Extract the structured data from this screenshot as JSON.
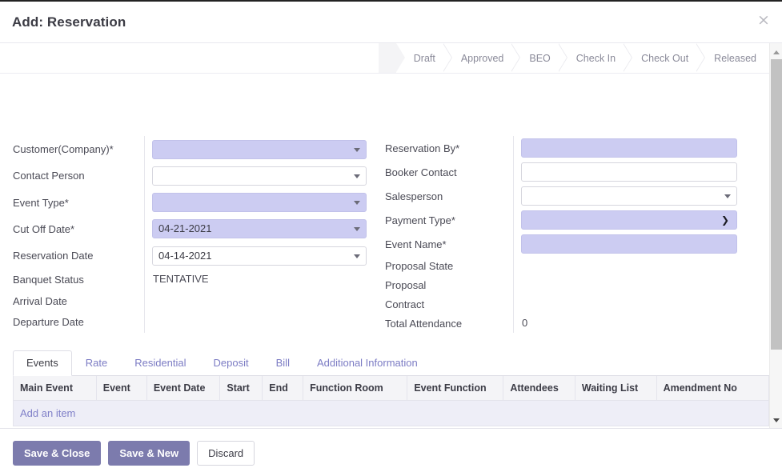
{
  "header": {
    "title": "Add: Reservation",
    "close_label": "×"
  },
  "statusbar": {
    "steps": [
      {
        "label": "Draft"
      },
      {
        "label": "Approved"
      },
      {
        "label": "BEO"
      },
      {
        "label": "Check In"
      },
      {
        "label": "Check Out"
      },
      {
        "label": "Released"
      }
    ]
  },
  "form": {
    "left": [
      {
        "label": "Customer(Company)*",
        "value": "",
        "type": "dropdown",
        "required": true
      },
      {
        "label": "Contact Person",
        "value": "",
        "type": "dropdown",
        "required": false
      },
      {
        "label": "Event Type*",
        "value": "",
        "type": "dropdown",
        "required": true
      },
      {
        "label": "Cut Off Date*",
        "value": "04-21-2021",
        "type": "dropdown",
        "required": true
      },
      {
        "label": "Reservation Date",
        "value": "04-14-2021",
        "type": "dropdown",
        "required": false
      },
      {
        "label": "Banquet Status",
        "value": "TENTATIVE",
        "type": "static",
        "required": false
      },
      {
        "label": "Arrival Date",
        "value": "",
        "type": "static",
        "required": false
      },
      {
        "label": "Departure Date",
        "value": "",
        "type": "static",
        "required": false
      }
    ],
    "right": [
      {
        "label": "Reservation By*",
        "value": "",
        "type": "text",
        "required": true
      },
      {
        "label": "Booker Contact",
        "value": "",
        "type": "text",
        "required": false
      },
      {
        "label": "Salesperson",
        "value": "",
        "type": "dropdown",
        "required": false
      },
      {
        "label": "Payment Type*",
        "value": "",
        "type": "select",
        "required": true
      },
      {
        "label": "Event Name*",
        "value": "",
        "type": "text",
        "required": true
      },
      {
        "label": "Proposal State",
        "value": "",
        "type": "static",
        "required": false
      },
      {
        "label": "Proposal",
        "value": "",
        "type": "static",
        "required": false
      },
      {
        "label": "Contract",
        "value": "",
        "type": "static",
        "required": false
      },
      {
        "label": "Total Attendance",
        "value": "0",
        "type": "static",
        "required": false
      }
    ]
  },
  "tabs": {
    "items": [
      {
        "label": "Events",
        "active": true
      },
      {
        "label": "Rate",
        "active": false
      },
      {
        "label": "Residential",
        "active": false
      },
      {
        "label": "Deposit",
        "active": false
      },
      {
        "label": "Bill",
        "active": false
      },
      {
        "label": "Additional Information",
        "active": false
      }
    ]
  },
  "table": {
    "columns": [
      "Main Event",
      "Event",
      "Event Date",
      "Start",
      "End",
      "Function Room",
      "Event Function",
      "Attendees",
      "Waiting List",
      "Amendment No"
    ],
    "rows": [],
    "add_item_label": "Add an item"
  },
  "footer": {
    "buttons": [
      {
        "label": "Save & Close",
        "style": "primary"
      },
      {
        "label": "Save & New",
        "style": "primary"
      },
      {
        "label": "Discard",
        "style": "secondary"
      }
    ]
  },
  "colors": {
    "accent": "#7c7bad",
    "required_field": "#ccccf2",
    "link": "#8080c8",
    "header_text": "#3b3b44"
  }
}
